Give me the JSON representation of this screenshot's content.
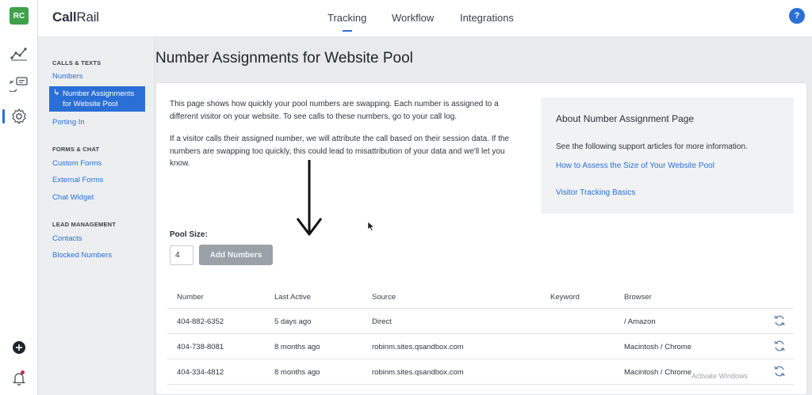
{
  "rail": {
    "badge": "RC",
    "icons": [
      "activity-chart-icon",
      "call-flow-icon",
      "settings-gear-icon",
      "add-circle-icon",
      "notification-bell-icon"
    ]
  },
  "header": {
    "logo_prefix": "Call",
    "logo_suffix": "Rail",
    "nav": [
      "Tracking",
      "Workflow",
      "Integrations"
    ],
    "active_nav": "Tracking",
    "help_label": "?"
  },
  "sidebar": {
    "sections": [
      {
        "title": "CALLS & TEXTS",
        "items": [
          "Numbers",
          "Number Assignments for Website Pool",
          "Porting In"
        ]
      },
      {
        "title": "FORMS & CHAT",
        "items": [
          "Custom Forms",
          "External Forms",
          "Chat Widget"
        ]
      },
      {
        "title": "LEAD MANAGEMENT",
        "items": [
          "Contacts",
          "Blocked Numbers"
        ]
      }
    ],
    "active_item": "Number Assignments for Website Pool"
  },
  "page": {
    "title": "Number Assignments for Website Pool",
    "intro_1": "This page shows how quickly your pool numbers are swapping. Each number is assigned to a different visitor on your website. To see calls to these numbers, go to your call log.",
    "intro_2": "If a visitor calls their assigned number, we will attribute the call based on their session data. If the numbers are swapping too quickly, this could lead to misattribution of your data and we'll let you know."
  },
  "about": {
    "title": "About Number Assignment Page",
    "description": "See the following support articles for more information.",
    "links": [
      "How to Assess the Size of Your Website Pool",
      "Visitor Tracking Basics"
    ]
  },
  "pool": {
    "label": "Pool Size:",
    "value": "4",
    "button_label": "Add Numbers"
  },
  "table": {
    "columns": [
      "Number",
      "Last Active",
      "Source",
      "Keyword",
      "Browser"
    ],
    "rows": [
      {
        "number": "404-882-6352",
        "last_active": "5 days ago",
        "source": "Direct",
        "keyword": "",
        "browser": "/ Amazon"
      },
      {
        "number": "404-738-8081",
        "last_active": "8 months ago",
        "source": "robinm.sites.qsandbox.com",
        "keyword": "",
        "browser": "Macintosh / Chrome"
      },
      {
        "number": "404-334-4812",
        "last_active": "8 months ago",
        "source": "robinm.sites.qsandbox.com",
        "keyword": "",
        "browser": "Macintosh / Chrome"
      }
    ]
  },
  "overlay": {
    "watermark": "Activate Windows"
  },
  "colors": {
    "accent": "#2a6fd6",
    "badge": "#3fa14a",
    "button_disabled": "#9aa1a9"
  }
}
